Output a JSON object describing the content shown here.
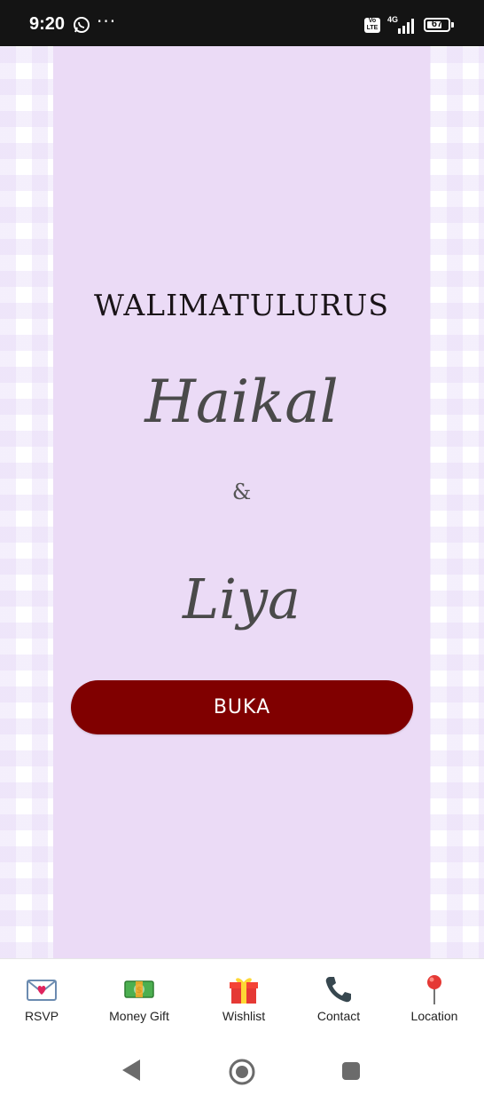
{
  "status_bar": {
    "time": "9:20",
    "network": "4G",
    "volte": "Vo LTE",
    "battery": "67",
    "more": "···"
  },
  "invitation": {
    "title": "WALIMATULURUS",
    "groom": "Haikal",
    "ampersand": "&",
    "bride": "Liya",
    "open_button": "BUKA"
  },
  "colors": {
    "card_bg": "#ebdbf6",
    "button_bg": "#800000"
  },
  "bottom_nav": {
    "items": [
      {
        "label": "RSVP",
        "icon": "love-letter-icon"
      },
      {
        "label": "Money Gift",
        "icon": "money-icon"
      },
      {
        "label": "Wishlist",
        "icon": "gift-icon"
      },
      {
        "label": "Contact",
        "icon": "phone-icon"
      },
      {
        "label": "Location",
        "icon": "pin-icon"
      }
    ]
  }
}
